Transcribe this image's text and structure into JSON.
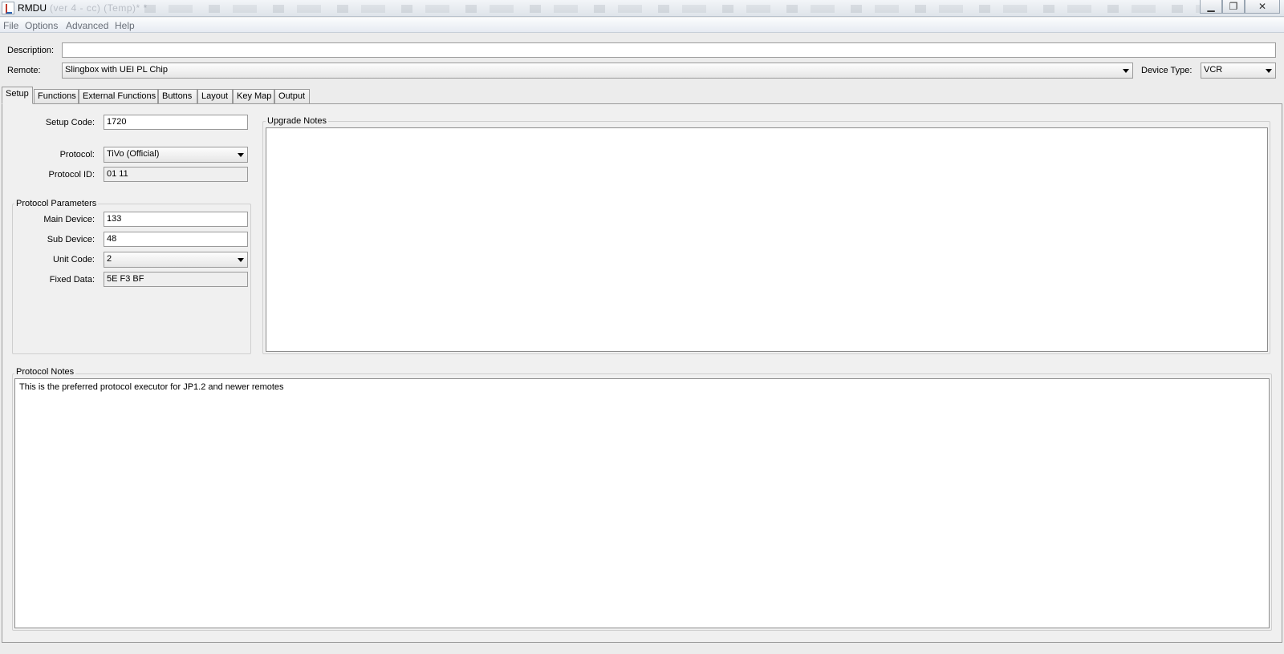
{
  "window": {
    "title": "RMDU",
    "subtitle": "(ver 4 - cc) (Temp)* *",
    "controls": {
      "minimize": "▁",
      "maximize": "❐",
      "close": "✕"
    }
  },
  "menu": {
    "items": [
      "File",
      "Options",
      "Advanced",
      "Help"
    ]
  },
  "form": {
    "description_label": "Description:",
    "description_value": "",
    "remote_label": "Remote:",
    "remote_value": "Slingbox with UEI PL Chip",
    "device_type_label": "Device Type:",
    "device_type_value": "VCR"
  },
  "tabs": [
    "Setup",
    "Functions",
    "External Functions",
    "Buttons",
    "Layout",
    "Key Map",
    "Output"
  ],
  "setup": {
    "setup_code_label": "Setup Code:",
    "setup_code_value": "1720",
    "protocol_label": "Protocol:",
    "protocol_value": "TiVo (Official)",
    "protocol_id_label": "Protocol ID:",
    "protocol_id_value": "01 11",
    "params_title": "Protocol Parameters",
    "main_device_label": "Main Device:",
    "main_device_value": "133",
    "sub_device_label": "Sub Device:",
    "sub_device_value": "48",
    "unit_code_label": "Unit Code:",
    "unit_code_value": "2",
    "fixed_data_label": "Fixed Data:",
    "fixed_data_value": "5E F3 BF",
    "upgrade_notes_title": "Upgrade Notes",
    "upgrade_notes_text": "",
    "protocol_notes_title": "Protocol Notes",
    "protocol_notes_text": "This is the preferred protocol executor for JP1.2 and newer remotes"
  },
  "icons": {
    "app": "app-java-icon",
    "dropdown": "chevron-down-icon"
  }
}
